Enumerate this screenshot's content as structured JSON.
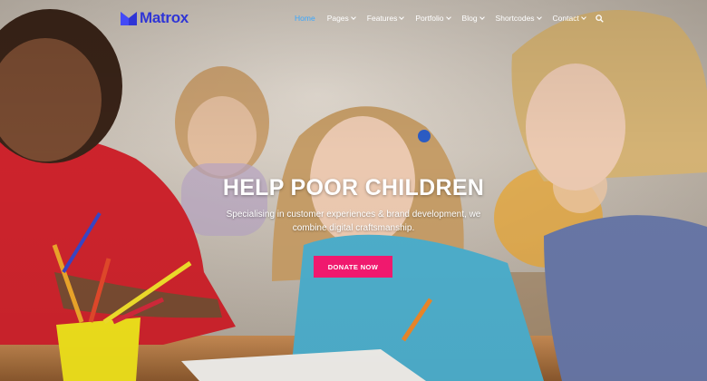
{
  "brand": {
    "name": "Matrox",
    "color": "#2f35d6"
  },
  "nav": {
    "items": [
      {
        "label": "Home",
        "active": true,
        "has_dropdown": false
      },
      {
        "label": "Pages",
        "active": false,
        "has_dropdown": true
      },
      {
        "label": "Features",
        "active": false,
        "has_dropdown": true
      },
      {
        "label": "Portfolio",
        "active": false,
        "has_dropdown": true
      },
      {
        "label": "Blog",
        "active": false,
        "has_dropdown": true
      },
      {
        "label": "Shortcodes",
        "active": false,
        "has_dropdown": true
      },
      {
        "label": "Contact",
        "active": false,
        "has_dropdown": true
      }
    ],
    "active_color": "#39a7ff",
    "search_icon": "search-icon"
  },
  "hero": {
    "title": "HELP POOR CHILDREN",
    "subtitle_line1": "Specialising in customer experiences & brand development, we",
    "subtitle_line2": "combine digital craftsmanship.",
    "cta_label": "DONATE NOW",
    "cta_color": "#f0196e"
  }
}
